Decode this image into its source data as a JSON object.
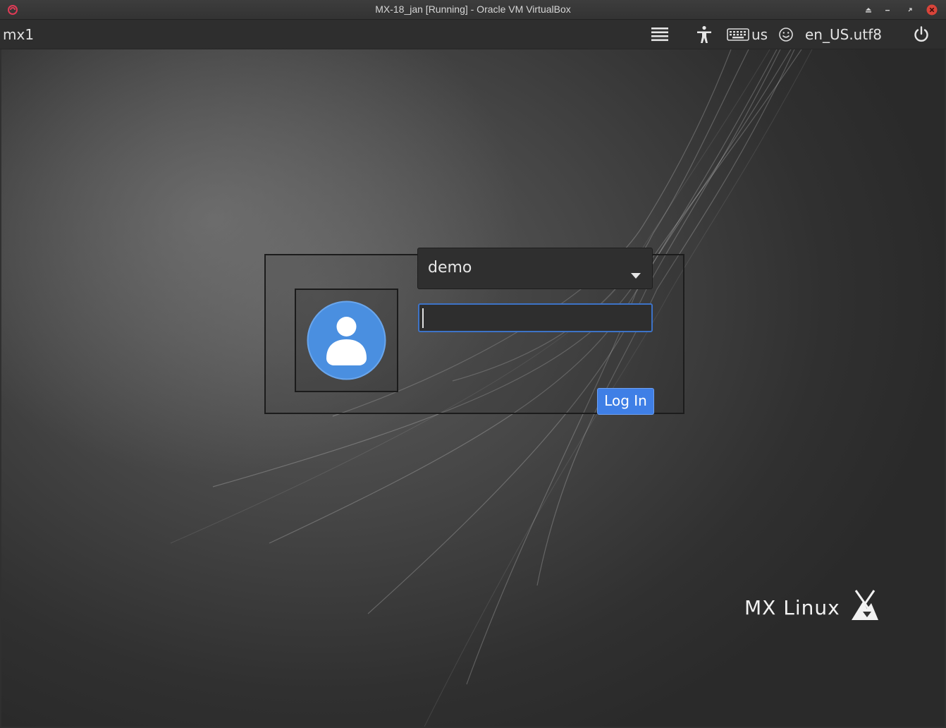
{
  "titlebar": {
    "title": "MX-18_jan [Running] - Oracle VM VirtualBox",
    "icons": [
      "virtualbox-icon",
      "eject-icon",
      "minimize-icon",
      "restore-icon",
      "close-icon"
    ]
  },
  "panel": {
    "hostname": "mx1",
    "keyboard_layout": "us",
    "locale": "en_US.utf8",
    "icons": [
      "session-menu-icon",
      "accessibility-icon",
      "keyboard-icon",
      "smiley-icon",
      "power-icon"
    ]
  },
  "login": {
    "selected_user": "demo",
    "password_value": "",
    "login_button_label": "Log In"
  },
  "branding": {
    "text": "MX Linux"
  },
  "colors": {
    "accent": "#3f7fe6",
    "focus_border": "#3d73c7",
    "avatar_blue": "#4a8fe0",
    "close_red": "#d9443a"
  }
}
